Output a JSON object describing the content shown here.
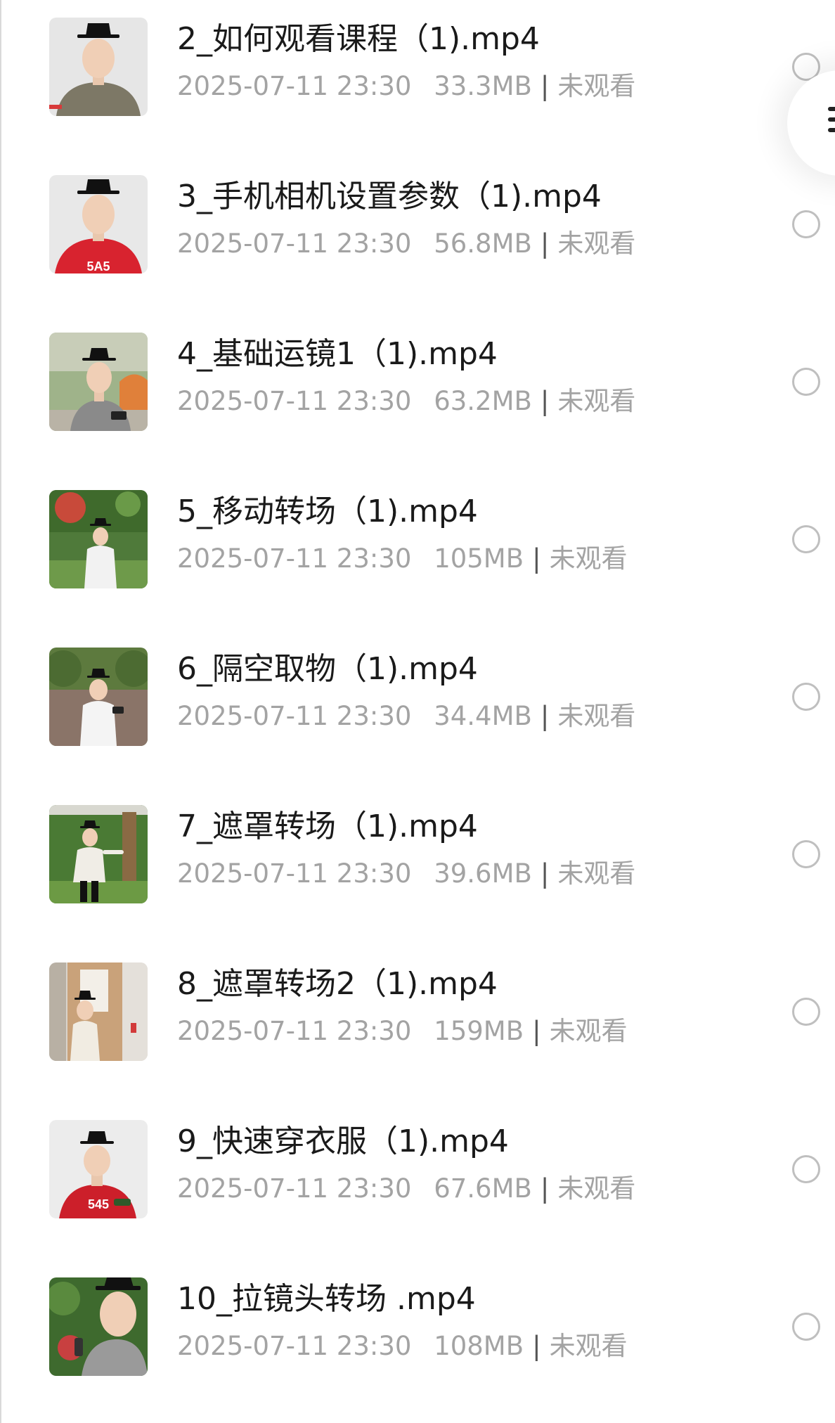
{
  "files": [
    {
      "title": "2_如何观看课程（1).mp4",
      "time": "2025-07-11 23:30",
      "size": "33.3MB",
      "status": "未观看",
      "thumb": "grey-hoodie"
    },
    {
      "title": "3_手机相机设置参数（1).mp4",
      "time": "2025-07-11 23:30",
      "size": "56.8MB",
      "status": "未观看",
      "thumb": "red-shirt"
    },
    {
      "title": "4_基础运镜1（1).mp4",
      "time": "2025-07-11 23:30",
      "size": "63.2MB",
      "status": "未观看",
      "thumb": "outdoor-grey"
    },
    {
      "title": "5_移动转场（1).mp4",
      "time": "2025-07-11 23:30",
      "size": "105MB",
      "status": "未观看",
      "thumb": "park-white"
    },
    {
      "title": "6_隔空取物（1).mp4",
      "time": "2025-07-11 23:30",
      "size": "34.4MB",
      "status": "未观看",
      "thumb": "wall-white"
    },
    {
      "title": "7_遮罩转场（1).mp4",
      "time": "2025-07-11 23:30",
      "size": "39.6MB",
      "status": "未观看",
      "thumb": "tree-jump"
    },
    {
      "title": "8_遮罩转场2（1).mp4",
      "time": "2025-07-11 23:30",
      "size": "159MB",
      "status": "未观看",
      "thumb": "doorway"
    },
    {
      "title": "9_快速穿衣服（1).mp4",
      "time": "2025-07-11 23:30",
      "size": "67.6MB",
      "status": "未观看",
      "thumb": "red-shirt-545"
    },
    {
      "title": "10_拉镜头转场 .mp4",
      "time": "2025-07-11 23:30",
      "size": "108MB",
      "status": "未观看",
      "thumb": "closeup-garden"
    }
  ],
  "separator": "|",
  "icons": {
    "select": "radio-circle-icon",
    "floating": "menu-icon"
  },
  "colors": {
    "title": "#1a1a1a",
    "meta": "#a3a3a3",
    "radio_border": "#bfbfbf"
  }
}
